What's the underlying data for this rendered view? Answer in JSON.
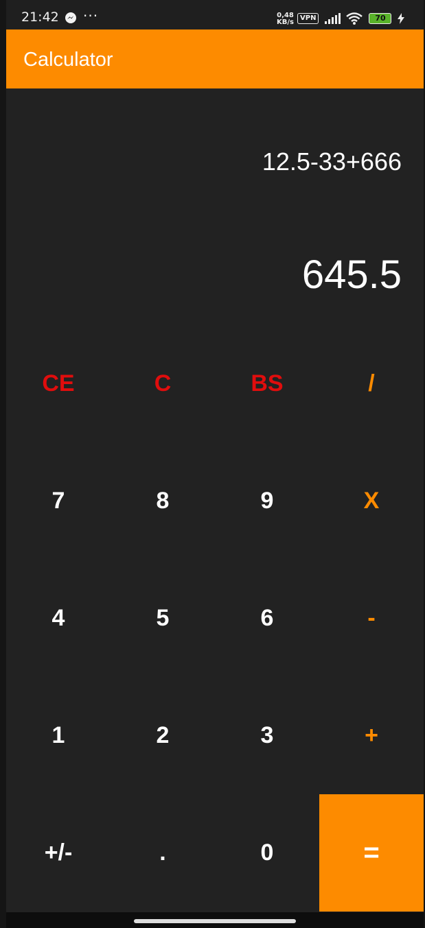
{
  "status_bar": {
    "time": "21:42",
    "more": "···",
    "speed_value": "0,48",
    "speed_unit": "KB/s",
    "vpn": "VPN",
    "battery": "70"
  },
  "app": {
    "title": "Calculator"
  },
  "display": {
    "expression": "12.5-33+666",
    "result": "645.5"
  },
  "keys": [
    {
      "label": "CE",
      "style": "red"
    },
    {
      "label": "C",
      "style": "red"
    },
    {
      "label": "BS",
      "style": "red"
    },
    {
      "label": "/",
      "style": "orange"
    },
    {
      "label": "7",
      "style": "white"
    },
    {
      "label": "8",
      "style": "white"
    },
    {
      "label": "9",
      "style": "white"
    },
    {
      "label": "X",
      "style": "orange"
    },
    {
      "label": "4",
      "style": "white"
    },
    {
      "label": "5",
      "style": "white"
    },
    {
      "label": "6",
      "style": "white"
    },
    {
      "label": "-",
      "style": "orange"
    },
    {
      "label": "1",
      "style": "white"
    },
    {
      "label": "2",
      "style": "white"
    },
    {
      "label": "3",
      "style": "white"
    },
    {
      "label": "+",
      "style": "orange"
    },
    {
      "label": "+/-",
      "style": "white"
    },
    {
      "label": ".",
      "style": "white"
    },
    {
      "label": "0",
      "style": "white"
    },
    {
      "label": "=",
      "style": "equals"
    }
  ],
  "colors": {
    "accent": "#fd8b00",
    "clear_keys": "#e00d0d",
    "background": "#222222"
  },
  "icons": [
    "messenger-icon",
    "signal-icon",
    "wifi-icon",
    "battery-icon",
    "charging-icon"
  ]
}
